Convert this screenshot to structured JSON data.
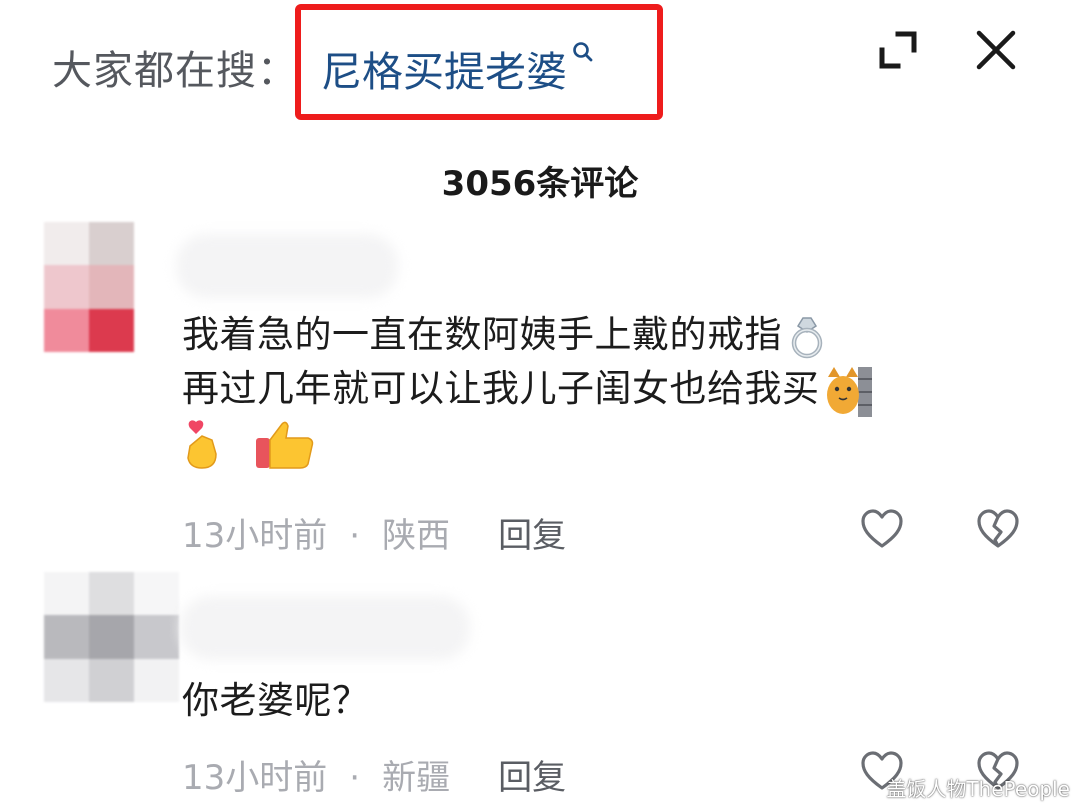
{
  "header": {
    "search_prefix": "大家都在搜：",
    "search_term": "尼格买提老婆",
    "search_icon": "search-icon",
    "expand_icon": "expand-icon",
    "close_icon": "close-icon",
    "highlight_color": "#ee1c1c",
    "link_color": "#1d4e86"
  },
  "comment_count": "3056条评论",
  "comments": [
    {
      "text_line1": "我着急的一直在数阿姨手上戴的戒指",
      "text_line2": "再过几年就可以让我儿子闺女也给我买",
      "emojis": [
        "ring-emoji",
        "cat-peeking-wall-emoji",
        "finger-heart-emoji",
        "thumbs-up-emoji"
      ],
      "time": "13小时前",
      "separator": "·",
      "location": "陕西",
      "reply_label": "回复"
    },
    {
      "text_line1": "你老婆呢？",
      "time": "13小时前",
      "separator": "·",
      "location": "新疆",
      "reply_label": "回复"
    }
  ],
  "watermark": "盖饭人物ThePeople"
}
